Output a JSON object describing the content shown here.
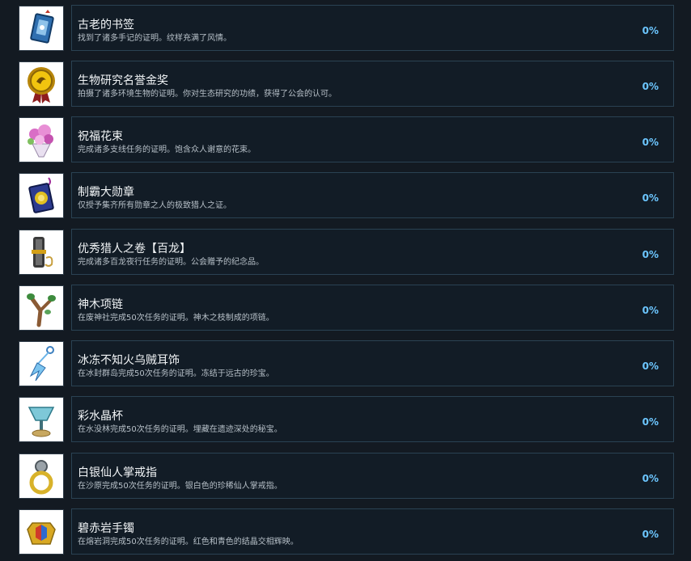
{
  "achievements": [
    {
      "title": "古老的书签",
      "desc": "找到了诸多手记的证明。纹样充满了风情。",
      "percent": "0%",
      "icon": "bookmark-icon"
    },
    {
      "title": "生物研究名誉金奖",
      "desc": "拍摄了诸多环境生物的证明。你对生态研究的功绩，获得了公会的认可。",
      "percent": "0%",
      "icon": "gold-medal-icon"
    },
    {
      "title": "祝福花束",
      "desc": "完成诸多支线任务的证明。饱含众人谢意的花束。",
      "percent": "0%",
      "icon": "bouquet-icon"
    },
    {
      "title": "制霸大勋章",
      "desc": "仅授予集齐所有勋章之人的极致猎人之证。",
      "percent": "0%",
      "icon": "grand-medal-icon"
    },
    {
      "title": "优秀猎人之卷【百龙】",
      "desc": "完成诸多百龙夜行任务的证明。公会赠予的纪念品。",
      "percent": "0%",
      "icon": "scroll-icon"
    },
    {
      "title": "神木项链",
      "desc": "在废神社完成50次任务的证明。神木之枝制成的项链。",
      "percent": "0%",
      "icon": "branch-necklace-icon"
    },
    {
      "title": "冰冻不知火乌贼耳饰",
      "desc": "在冰封群岛完成50次任务的证明。冻结于远古的珍宝。",
      "percent": "0%",
      "icon": "ice-earring-icon"
    },
    {
      "title": "彩水晶杯",
      "desc": "在水没林完成50次任务的证明。埋藏在遗迹深处的秘宝。",
      "percent": "0%",
      "icon": "crystal-cup-icon"
    },
    {
      "title": "白银仙人掌戒指",
      "desc": "在沙原完成50次任务的证明。银白色的珍稀仙人掌戒指。",
      "percent": "0%",
      "icon": "silver-ring-icon"
    },
    {
      "title": "碧赤岩手镯",
      "desc": "在熔岩洞完成50次任务的证明。红色和青色的结晶交相辉映。",
      "percent": "0%",
      "icon": "bracelet-icon"
    }
  ]
}
